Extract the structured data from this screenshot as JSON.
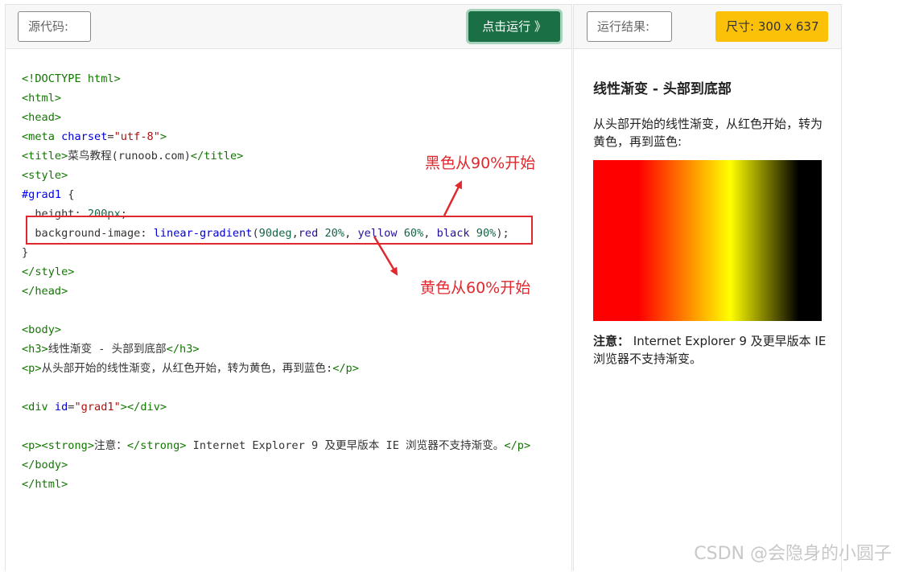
{
  "editor": {
    "source_label": "源代码:",
    "run_label": "点击运行 》",
    "code_lines": [
      [
        {
          "c": "tag",
          "t": "<!DOCTYPE html>"
        }
      ],
      [
        {
          "c": "tag",
          "t": "<html>"
        }
      ],
      [
        {
          "c": "tag",
          "t": "<head>"
        }
      ],
      [
        {
          "c": "tag",
          "t": "<meta "
        },
        {
          "c": "attr",
          "t": "charset"
        },
        {
          "c": "",
          "t": "="
        },
        {
          "c": "str",
          "t": "\"utf-8\""
        },
        {
          "c": "tag",
          "t": ">"
        }
      ],
      [
        {
          "c": "tag",
          "t": "<title>"
        },
        {
          "c": "",
          "t": "菜鸟教程(runoob.com)"
        },
        {
          "c": "tag",
          "t": "</title>"
        }
      ],
      [
        {
          "c": "tag",
          "t": "<style>"
        }
      ],
      [
        {
          "c": "sel",
          "t": "#grad1"
        },
        {
          "c": "",
          "t": " {"
        }
      ],
      [
        {
          "c": "",
          "t": "  height: "
        },
        {
          "c": "num",
          "t": "200px"
        },
        {
          "c": "",
          "t": ";"
        }
      ],
      [
        {
          "c": "",
          "t": "  background-image: "
        },
        {
          "c": "fn",
          "t": "linear-gradient"
        },
        {
          "c": "",
          "t": "("
        },
        {
          "c": "num",
          "t": "90deg"
        },
        {
          "c": "",
          "t": ","
        },
        {
          "c": "kw",
          "t": "red"
        },
        {
          "c": "",
          "t": " "
        },
        {
          "c": "num",
          "t": "20%"
        },
        {
          "c": "",
          "t": ", "
        },
        {
          "c": "kw",
          "t": "yellow"
        },
        {
          "c": "",
          "t": " "
        },
        {
          "c": "num",
          "t": "60%"
        },
        {
          "c": "",
          "t": ", "
        },
        {
          "c": "kw",
          "t": "black"
        },
        {
          "c": "",
          "t": " "
        },
        {
          "c": "num",
          "t": "90%"
        },
        {
          "c": "",
          "t": ");"
        }
      ],
      [
        {
          "c": "",
          "t": "}"
        }
      ],
      [
        {
          "c": "tag",
          "t": "</style>"
        }
      ],
      [
        {
          "c": "tag",
          "t": "</head>"
        }
      ],
      [
        {
          "c": "",
          "t": ""
        }
      ],
      [
        {
          "c": "tag",
          "t": "<body>"
        }
      ],
      [
        {
          "c": "tag",
          "t": "<h3>"
        },
        {
          "c": "",
          "t": "线性渐变 - 头部到底部"
        },
        {
          "c": "tag",
          "t": "</h3>"
        }
      ],
      [
        {
          "c": "tag",
          "t": "<p>"
        },
        {
          "c": "",
          "t": "从头部开始的线性渐变，从红色开始，转为黄色，再到蓝色:"
        },
        {
          "c": "tag",
          "t": "</p>"
        }
      ],
      [
        {
          "c": "",
          "t": ""
        }
      ],
      [
        {
          "c": "tag",
          "t": "<div "
        },
        {
          "c": "attr",
          "t": "id"
        },
        {
          "c": "",
          "t": "="
        },
        {
          "c": "str",
          "t": "\"grad1\""
        },
        {
          "c": "tag",
          "t": "></div>"
        }
      ],
      [
        {
          "c": "",
          "t": ""
        }
      ],
      [
        {
          "c": "tag",
          "t": "<p><strong>"
        },
        {
          "c": "",
          "t": "注意："
        },
        {
          "c": "tag",
          "t": "</strong>"
        },
        {
          "c": "",
          "t": " Internet Explorer 9 及更早版本 IE 浏览器不支持渐变。"
        },
        {
          "c": "tag",
          "t": "</p>"
        }
      ],
      [
        {
          "c": "tag",
          "t": "</body>"
        }
      ],
      [
        {
          "c": "tag",
          "t": "</html>"
        }
      ]
    ]
  },
  "annotations": {
    "black": "黑色从90%开始",
    "yellow": "黄色从60%开始",
    "color": "#e0282e"
  },
  "result": {
    "label": "运行结果:",
    "size_badge": "尺寸: 300 x 637",
    "heading": "线性渐变 - 头部到底部",
    "description": "从头部开始的线性渐变，从红色开始，转为黄色，再到蓝色:",
    "note_strong": "注意：",
    "note_text": " Internet Explorer 9 及更早版本 IE 浏览器不支持渐变。"
  },
  "watermark": "CSDN @会隐身的小圆子",
  "colors": {
    "run_button": "#1a7044",
    "size_badge": "#fbc108"
  }
}
